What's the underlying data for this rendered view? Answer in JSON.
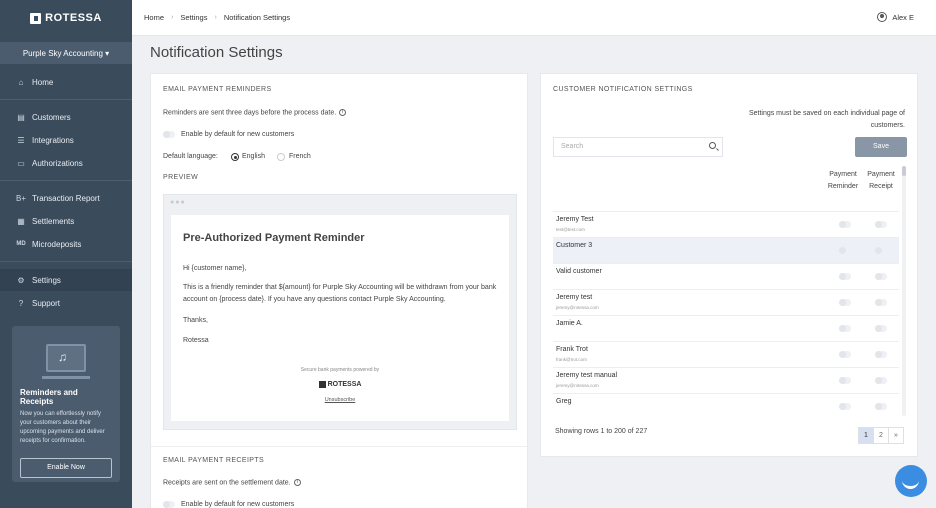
{
  "brand": {
    "name": "ROTESSA"
  },
  "sidebar": {
    "account": "Purple Sky Accounting ▾",
    "items": [
      {
        "icon": "home-icon",
        "glyph": "⌂",
        "label": "Home"
      },
      {
        "icon": "customers-icon",
        "glyph": "▤",
        "label": "Customers"
      },
      {
        "icon": "integrations-icon",
        "glyph": "☰",
        "label": "Integrations"
      },
      {
        "icon": "authorizations-icon",
        "glyph": "▭",
        "label": "Authorizations"
      },
      {
        "icon": "transaction-report-icon",
        "glyph": "B+",
        "label": "Transaction Report"
      },
      {
        "icon": "settlements-icon",
        "glyph": "▦",
        "label": "Settlements"
      },
      {
        "icon": "microdeposits-icon",
        "glyph": "MD",
        "label": "Microdeposits"
      },
      {
        "icon": "gear-icon",
        "glyph": "⚙",
        "label": "Settings"
      },
      {
        "icon": "support-icon",
        "glyph": "?",
        "label": "Support"
      }
    ],
    "promo": {
      "title": "Reminders and Receipts",
      "text": "Now you can effortlessly notify your customers about their upcoming payments and deliver receipts for confirmation.",
      "button": "Enable Now"
    }
  },
  "topbar": {
    "breadcrumb": [
      "Home",
      "Settings",
      "Notification Settings"
    ],
    "user": "Alex E"
  },
  "page_title": "Notification Settings",
  "reminders": {
    "title": "EMAIL PAYMENT REMINDERS",
    "note": "Reminders are sent three days before the process date.",
    "enable_label": "Enable by default for new customers",
    "language_label": "Default language:",
    "lang_en": "English",
    "lang_fr": "French",
    "preview_label": "PREVIEW",
    "preview": {
      "title": "Pre-Authorized Payment Reminder",
      "greeting": "Hi {customer name},",
      "body": "This is a friendly reminder that ${amount} for Purple Sky Accounting will be withdrawn from your bank account on {process date}. If you have any questions contact Purple Sky Accounting.",
      "thanks": "Thanks,",
      "sign": "Rotessa",
      "powered": "Secure bank payments powered by",
      "logo": "ROTESSA",
      "unsubscribe": "Unsubscribe"
    }
  },
  "receipts": {
    "title": "EMAIL PAYMENT RECEIPTS",
    "note": "Receipts are sent on the settlement date.",
    "enable_label": "Enable by default for new customers"
  },
  "customer_settings": {
    "title": "CUSTOMER NOTIFICATION SETTINGS",
    "save_note": "Settings must be saved on each individual page of customers.",
    "search_placeholder": "Search",
    "save_label": "Save",
    "col_reminder": "Payment Reminder",
    "col_receipt": "Payment Receipt",
    "rows": [
      {
        "name": "Jeremy Test",
        "email": "test@test.com"
      },
      {
        "name": "Customer 3",
        "email": ""
      },
      {
        "name": "Valid customer",
        "email": ""
      },
      {
        "name": "Jeremy test",
        "email": "jeremy@rotessa.com"
      },
      {
        "name": "Jamie A.",
        "email": ""
      },
      {
        "name": "Frank Trot",
        "email": "frank@trot.com"
      },
      {
        "name": "Jeremy test manual",
        "email": "jeremy@rotessa.com"
      },
      {
        "name": "Greg",
        "email": ""
      }
    ],
    "showing": "Showing rows 1 to 200 of 227",
    "pages": [
      "1",
      "2",
      "»"
    ]
  }
}
